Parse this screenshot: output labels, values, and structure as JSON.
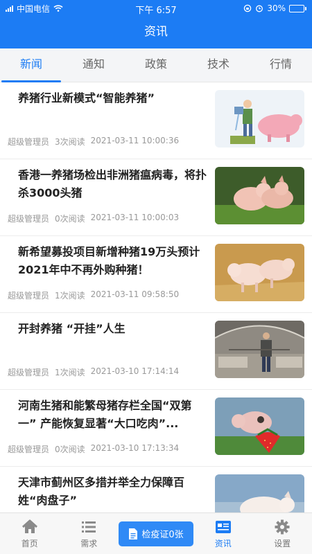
{
  "status_bar": {
    "carrier": "中国电信",
    "time": "下午 6:57",
    "battery": "30%",
    "battery_level": 0.3
  },
  "nav": {
    "title": "资讯"
  },
  "tabs": [
    {
      "label": "新闻",
      "active": true
    },
    {
      "label": "通知",
      "active": false
    },
    {
      "label": "政策",
      "active": false
    },
    {
      "label": "技术",
      "active": false
    },
    {
      "label": "行情",
      "active": false
    }
  ],
  "news": [
    {
      "title": "养猪行业新模式“智能养猪”",
      "author": "超级管理员",
      "reads": "3次阅读",
      "time": "2021-03-11 10:00:36",
      "image_icon": "cartoon-farmer-feeding-pig"
    },
    {
      "title": "香港一养猪场检出非洲猪瘟病毒，将扑杀3000头猪",
      "author": "超级管理员",
      "reads": "0次阅读",
      "time": "2021-03-11 10:00:03",
      "image_icon": "piglets-on-grass"
    },
    {
      "title": "新希望募投项目新增种猪19万头预计2021年中不再外购种猪！",
      "author": "超级管理员",
      "reads": "1次阅读",
      "time": "2021-03-11 09:58:50",
      "image_icon": "piglets-on-straw"
    },
    {
      "title": "开封养猪 “开挂”人生",
      "author": "超级管理员",
      "reads": "1次阅读",
      "time": "2021-03-10 17:14:14",
      "image_icon": "man-in-pig-barn"
    },
    {
      "title": "河南生猪和能繁母猪存栏全国“双第一” 产能恢复显著“大口吃肉”...",
      "author": "超级管理员",
      "reads": "0次阅读",
      "time": "2021-03-10 17:13:34",
      "image_icon": "piglet-with-strawberry"
    },
    {
      "title": "天津市蓟州区多措并举全力保障百姓“肉盘子”",
      "author": "",
      "reads": "",
      "time": "",
      "image_icon": "white-pig"
    }
  ],
  "tabbar": {
    "home": {
      "label": "首页",
      "icon": "home-icon"
    },
    "demand": {
      "label": "需求",
      "icon": "list-icon"
    },
    "cert": {
      "label": "检疫证0张",
      "icon": "document-icon"
    },
    "news": {
      "label": "资讯",
      "icon": "news-icon",
      "active": true
    },
    "settings": {
      "label": "设置",
      "icon": "gear-icon"
    }
  },
  "colors": {
    "accent": "#1c7cf4",
    "header_bg": "#1c7cf4",
    "cert_button": "#2f8af6"
  }
}
